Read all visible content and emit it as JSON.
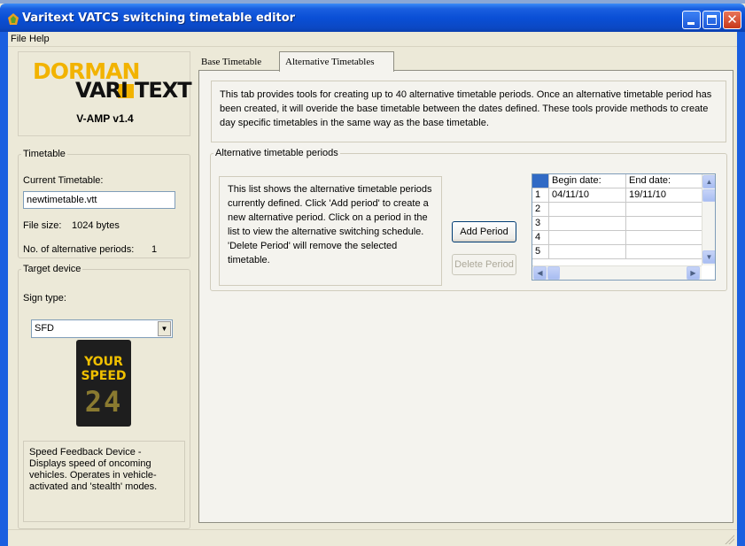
{
  "window": {
    "title": "Varitext VATCS switching timetable editor"
  },
  "menu": {
    "items": [
      {
        "label": "File"
      },
      {
        "label": "Help"
      }
    ]
  },
  "logo": {
    "brand_top": "DORMAN",
    "brand_bottom_a": "VARI",
    "brand_bottom_b": "I",
    "brand_bottom_c": "TEXT",
    "version": "V-AMP v1.4",
    "brand_color": "#f2b300"
  },
  "timetable": {
    "group_label": "Timetable",
    "current_label": "Current Timetable:",
    "current_value": "newtimetable.vtt",
    "file_size_label": "File size:",
    "file_size_value": "1024 bytes",
    "alt_periods_label": "No. of alternative periods:",
    "alt_periods_value": "1"
  },
  "target_device": {
    "group_label": "Target device",
    "sign_type_label": "Sign type:",
    "sign_type_value": "SFD",
    "sign_line1": "YOUR",
    "sign_line2": "SPEED",
    "sign_number": "24",
    "description": "Speed Feedback Device - Displays speed of oncoming vehicles. Operates in vehicle-activated and 'stealth' modes."
  },
  "tabs": [
    {
      "label": "Base Timetable",
      "active": false
    },
    {
      "label": "Alternative Timetables",
      "active": true
    }
  ],
  "alt_tab": {
    "intro": "This tab provides tools for creating up to 40 alternative timetable periods. Once an alternative timetable period has been created, it will overide the base timetable between the dates defined. These tools provide methods to create day specific timetables in the same way as the base timetable.",
    "group_label": "Alternative timetable periods",
    "list_description": "This list shows the alternative timetable periods currently defined. Click 'Add period' to create a new alternative period. Click on a period in the list to view the alternative switching schedule. 'Delete Period' will remove the selected timetable.",
    "add_button": "Add Period",
    "delete_button": "Delete Period",
    "grid": {
      "columns": [
        "Begin date:",
        "End date:"
      ],
      "rows": [
        {
          "num": "1",
          "begin": "04/11/10",
          "end": "19/11/10"
        },
        {
          "num": "2",
          "begin": "",
          "end": ""
        },
        {
          "num": "3",
          "begin": "",
          "end": ""
        },
        {
          "num": "4",
          "begin": "",
          "end": ""
        },
        {
          "num": "5",
          "begin": "",
          "end": ""
        }
      ]
    }
  },
  "icons": {
    "app": "app-icon",
    "minimize": "minimize-icon",
    "maximize": "maximize-icon",
    "close": "close-icon",
    "dropdown": "chevron-down-icon"
  },
  "colors": {
    "titlebar": "#0a4fd6",
    "close_button": "#c8381a",
    "selection": "#316ac5"
  }
}
